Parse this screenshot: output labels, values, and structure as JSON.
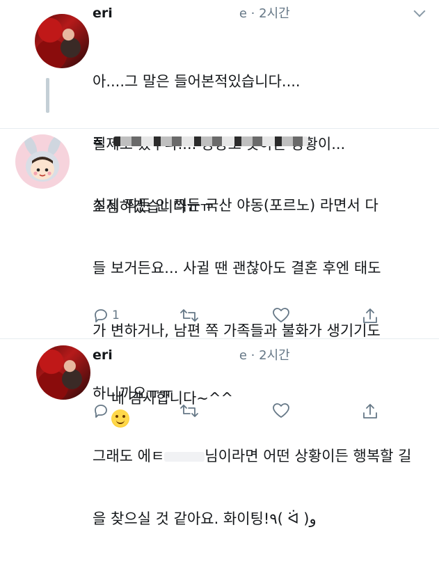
{
  "tweets": [
    {
      "name": "eri",
      "meta": "e · 2시간",
      "lines": [
        "아....그 말은 들어본적있습니다....",
        "실제로 있구나.... 상상도 못하는 상황이...",
        "조심하겠습니다ㅠㅠ"
      ]
    },
    {
      "name": "≡",
      "lines": [
        "실제 찍든 안 찍든 국산 야동(포르노) 라면서 다",
        "들 보거든요... 사귈 땐 괜찮아도 결혼 후엔 태도",
        "가 변하거나, 남편 쪽 가족들과 불화가 생기기도",
        "하니까요ㅠㅠ"
      ],
      "line5_pre": "그래도 에ㅌ",
      "line5_post": "님이라면 어떤 상황이든 행복할 길",
      "line6": "을 찾으실 것 같아요. 화이팅!٩( ᐛ )و",
      "reply_count": "1"
    },
    {
      "name": "eri",
      "meta": "e · 2시간",
      "text": "네 감사합니다~^^"
    }
  ],
  "icons": [
    "reply-icon",
    "retweet-icon",
    "like-icon",
    "share-icon",
    "chevron-down-icon",
    "smile-emoji"
  ]
}
